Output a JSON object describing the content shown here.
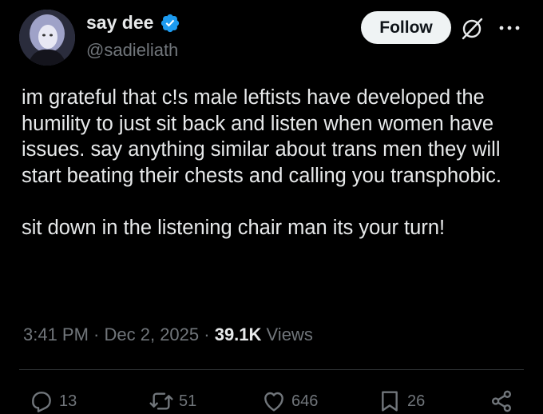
{
  "author": {
    "display_name": "say dee",
    "handle": "@sadieliath",
    "verified_icon": "verified-badge-icon"
  },
  "header": {
    "follow_label": "Follow",
    "grok_icon": "grok-icon",
    "more_icon": "more-icon"
  },
  "tweet": {
    "paragraphs": [
      "im grateful that c!s male leftists have developed the humility to just sit back and listen when women have issues. say anything similar about trans men they will start beating their chests and calling you transphobic.",
      "sit down in the listening chair man its your turn!"
    ]
  },
  "meta": {
    "time": "3:41 PM",
    "sep1": " · ",
    "date": "Dec 2, 2025",
    "sep2": " · ",
    "views_count": "39.1K",
    "views_label": " Views"
  },
  "actions": {
    "replies": "13",
    "reposts": "51",
    "likes": "646",
    "bookmarks": "26"
  },
  "colors": {
    "background": "#000000",
    "text": "#e7e9ea",
    "muted": "#71767b",
    "verified": "#1d9bf0",
    "follow_bg": "#eff3f4"
  }
}
